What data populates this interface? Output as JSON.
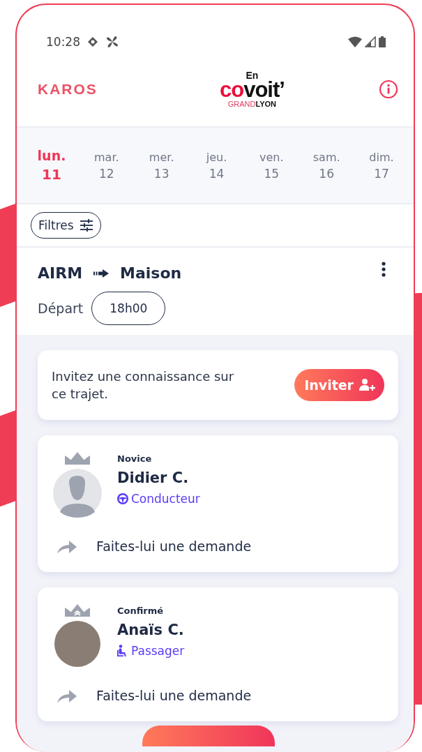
{
  "status_bar": {
    "time": "10:28"
  },
  "header": {
    "brand": "KAROS",
    "partner_logo": {
      "top": "En",
      "main_accent": "co",
      "main": "voit’",
      "bottom_accent": "GRAND",
      "bottom": "LYON"
    }
  },
  "days": [
    {
      "weekday": "lun.",
      "date": "11",
      "selected": true
    },
    {
      "weekday": "mar.",
      "date": "12",
      "selected": false
    },
    {
      "weekday": "mer.",
      "date": "13",
      "selected": false
    },
    {
      "weekday": "jeu.",
      "date": "14",
      "selected": false
    },
    {
      "weekday": "ven.",
      "date": "15",
      "selected": false
    },
    {
      "weekday": "sam.",
      "date": "16",
      "selected": false
    },
    {
      "weekday": "dim.",
      "date": "17",
      "selected": false
    }
  ],
  "filters": {
    "label": "Filtres"
  },
  "route": {
    "from": "AIRM",
    "to": "Maison",
    "departure_label": "Départ",
    "departure_time": "18h00"
  },
  "invite": {
    "text": "Invitez une connaissance sur ce trajet.",
    "button": "Inviter"
  },
  "members": [
    {
      "level": "Novice",
      "name": "Didier C.",
      "role": "Conducteur",
      "kind": "driver",
      "has_photo": false,
      "action": "Faites-lui une demande"
    },
    {
      "level": "Confirmé",
      "name": "Anaïs C.",
      "role": "Passager",
      "kind": "passenger",
      "has_photo": true,
      "action": "Faites-lui une demande"
    }
  ]
}
